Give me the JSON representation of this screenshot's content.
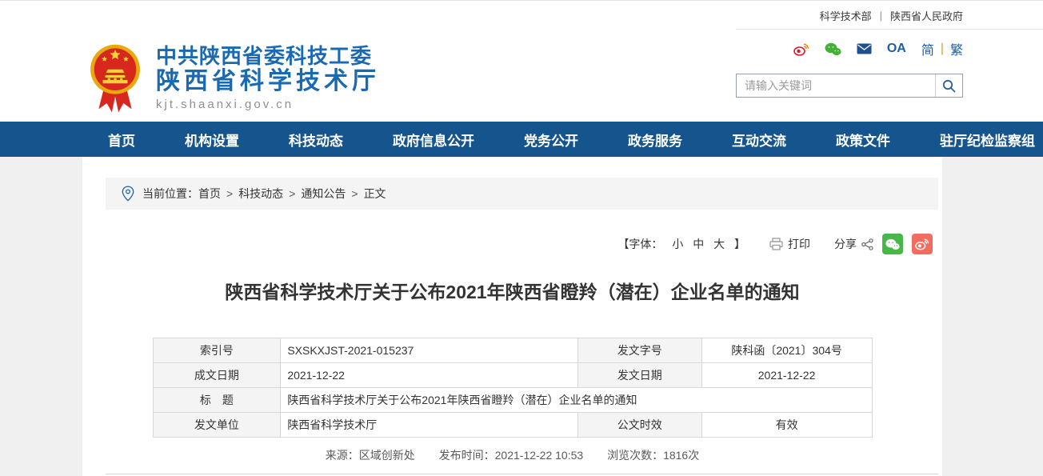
{
  "topbar": {
    "separator": "|",
    "links": [
      {
        "label": "科学技术部"
      },
      {
        "label": "陕西省人民政府"
      }
    ]
  },
  "header": {
    "org_line1": "中共陕西省委科技工委",
    "org_line2": "陕西省科学技术厅",
    "site_url": "kjt.shaanxi.gov.cn",
    "oa_label": "OA",
    "lang_simplified": "简",
    "lang_separator": "|",
    "lang_traditional": "繁",
    "search": {
      "placeholder": "请输入关键词"
    }
  },
  "nav": {
    "items": [
      "首页",
      "机构设置",
      "科技动态",
      "政府信息公开",
      "党务公开",
      "政务服务",
      "互动交流",
      "政策文件",
      "驻厅纪检监察组"
    ]
  },
  "breadcrumb": {
    "prefix": "当前位置：",
    "separator": ">",
    "items": [
      "首页",
      "科技动态",
      "通知公告",
      "正文"
    ]
  },
  "toolbar": {
    "font_open": "【字体：",
    "font_small": "小",
    "font_medium": "中",
    "font_large": "大",
    "font_close": "】",
    "print_label": "打印",
    "share_label": "分享"
  },
  "article": {
    "title": "陕西省科学技术厅关于公布2021年陕西省瞪羚（潜在）企业名单的通知",
    "info_table": {
      "rows": [
        {
          "cells": [
            {
              "label": "索引号",
              "value": "SXSKXJST-2021-015237"
            },
            {
              "label": "发文字号",
              "value": "陕科函〔2021〕304号"
            }
          ]
        },
        {
          "cells": [
            {
              "label": "成文日期",
              "value": "2021-12-22"
            },
            {
              "label": "发文日期",
              "value": "2021-12-22"
            }
          ]
        },
        {
          "cells": [
            {
              "label": "标　题",
              "value": "陕西省科学技术厅关于公布2021年陕西省瞪羚（潜在）企业名单的通知"
            }
          ]
        },
        {
          "cells": [
            {
              "label": "发文单位",
              "value": "陕西省科学技术厅"
            },
            {
              "label": "公文时效",
              "value": "有效"
            }
          ]
        }
      ]
    },
    "meta": {
      "source_label": "来源：",
      "source": "区域创新处",
      "publish_label": "发布时间：",
      "publish_time": "2021-12-22 10:53",
      "views_label": "浏览次数：",
      "views": "1816次"
    }
  },
  "icons": {
    "logo": "national-emblem",
    "top_icons": [
      "weibo-icon",
      "wechat-icon",
      "mail-icon"
    ],
    "search": "search-icon",
    "breadcrumb": "location-pin-icon",
    "toolbar": [
      "printer-icon",
      "share-nodes-icon",
      "wechat-share-icon",
      "weibo-share-icon"
    ]
  },
  "colors": {
    "nav_bg": "#15548c",
    "brand_blue": "#1b69b1",
    "wechat_green": "#49b649",
    "weibo_red": "#f26d60",
    "page_bg": "#f0f0f0",
    "strip_bg": "#f4f4f4"
  }
}
